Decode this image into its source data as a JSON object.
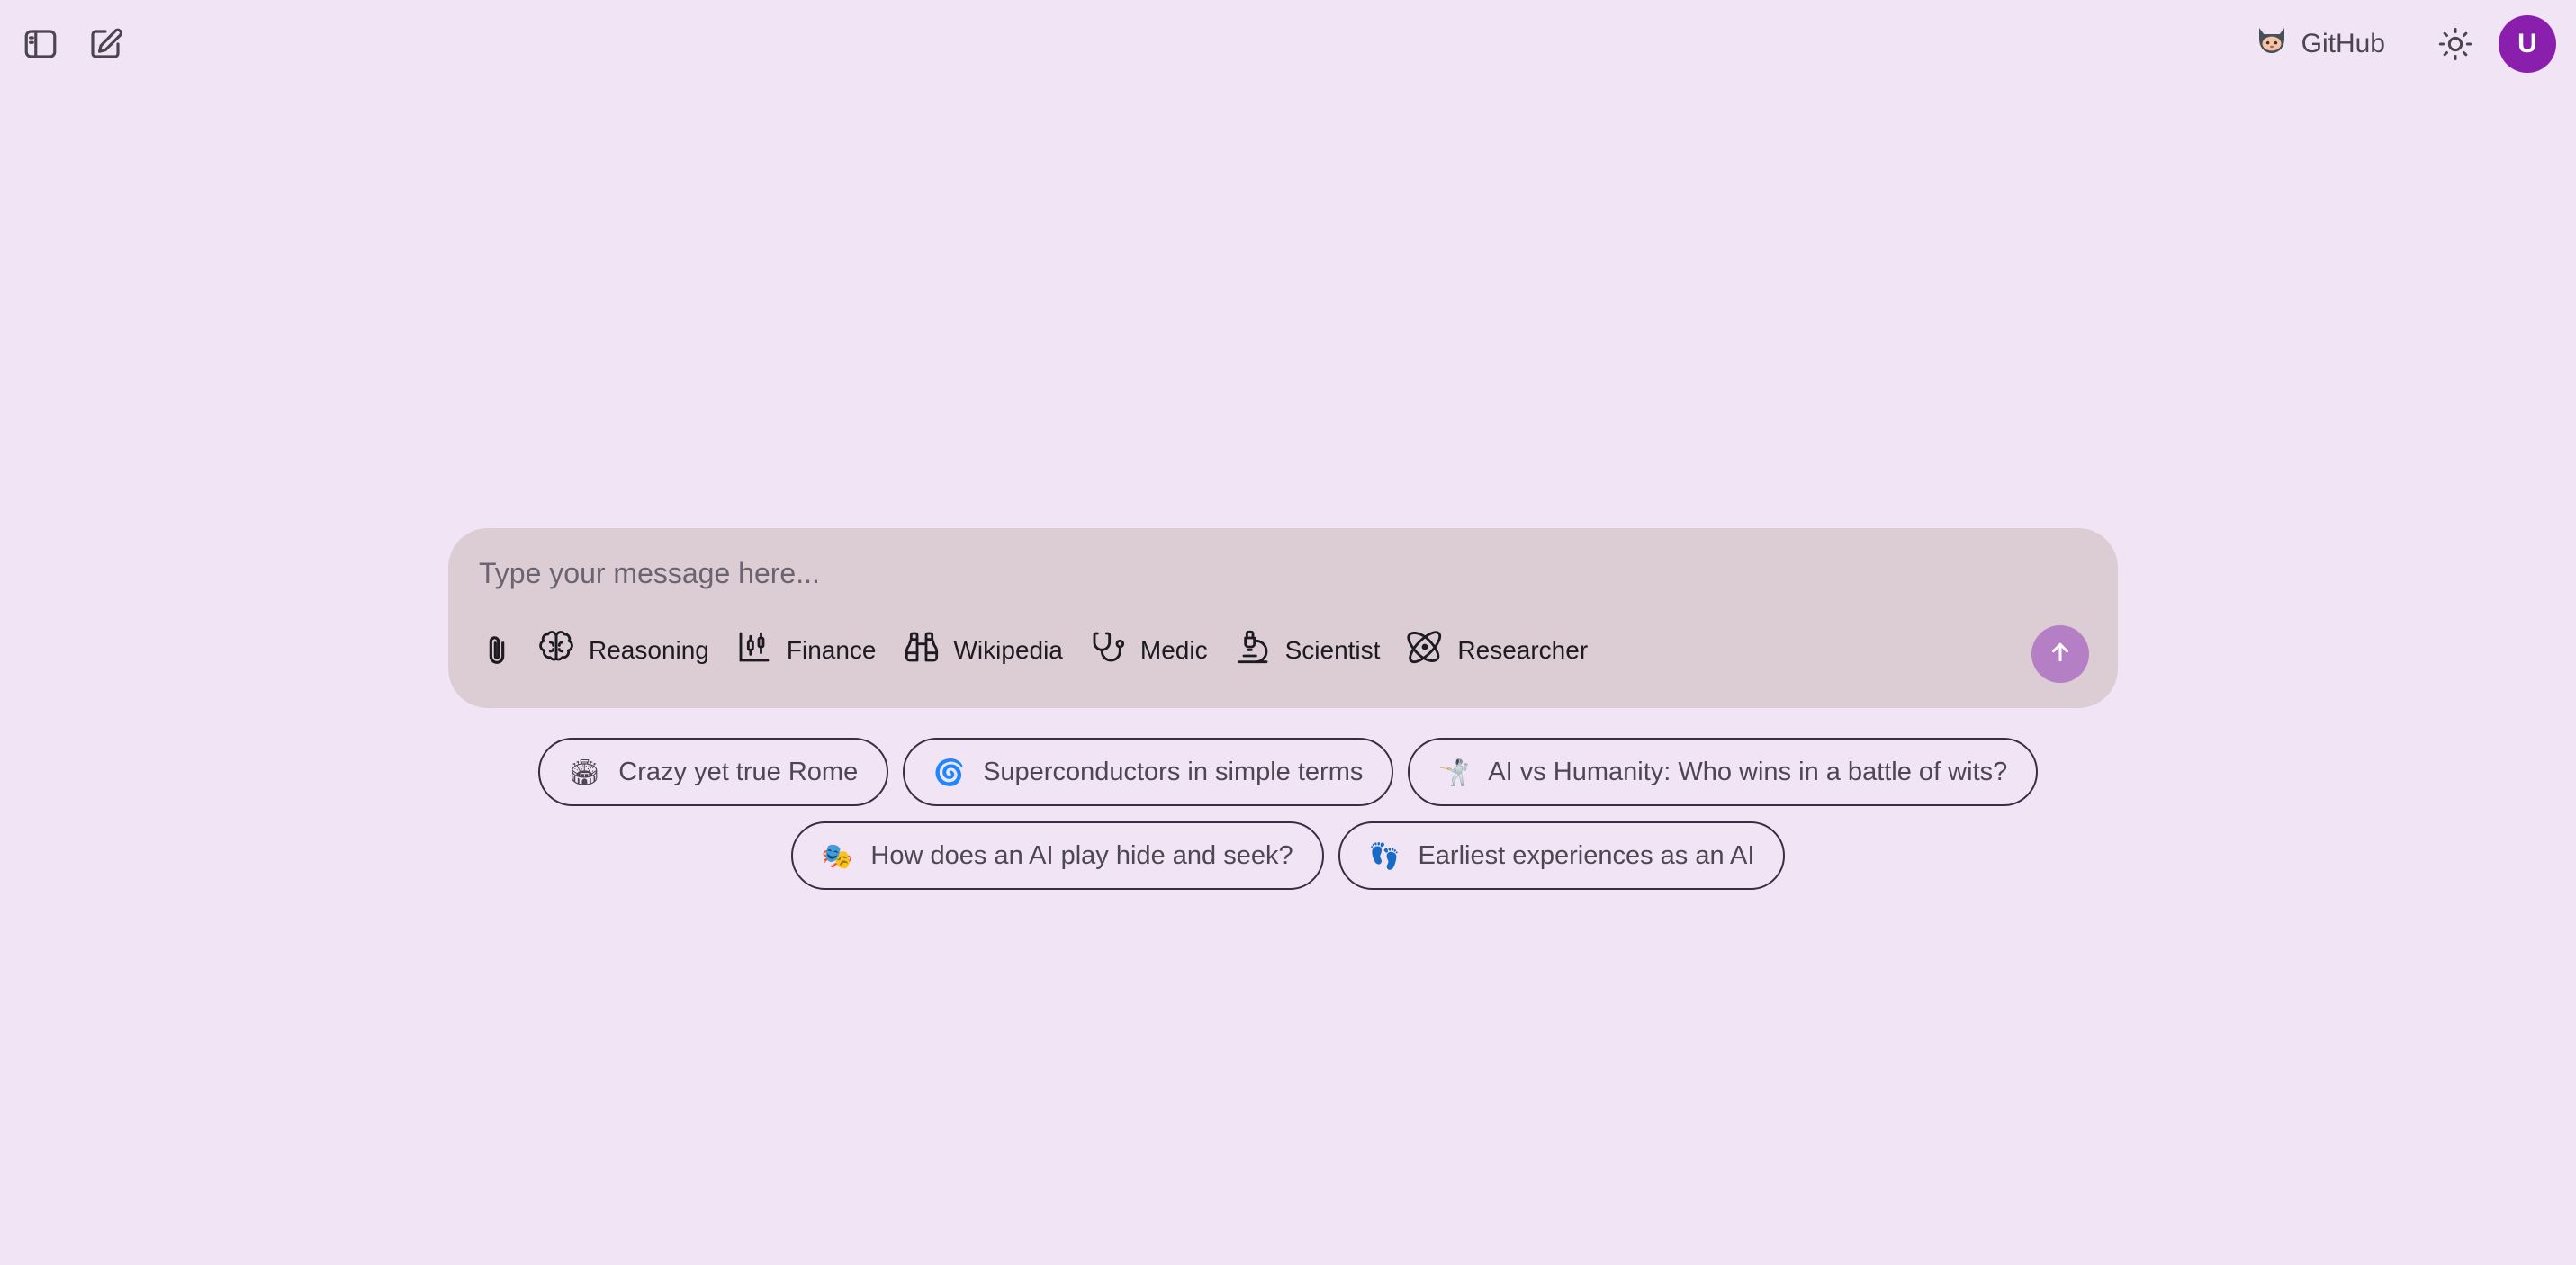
{
  "header": {
    "github_label": "GitHub",
    "avatar_initial": "U",
    "icons": {
      "sidebar_toggle": "sidebar-toggle-icon",
      "new_chat": "edit-icon",
      "github": "github-icon",
      "theme": "sun-icon"
    }
  },
  "composer": {
    "placeholder": "Type your message here...",
    "value": "",
    "tools": [
      {
        "label": "Reasoning",
        "icon": "brain-icon"
      },
      {
        "label": "Finance",
        "icon": "candlestick-chart-icon"
      },
      {
        "label": "Wikipedia",
        "icon": "binoculars-icon"
      },
      {
        "label": "Medic",
        "icon": "stethoscope-icon"
      },
      {
        "label": "Scientist",
        "icon": "microscope-icon"
      },
      {
        "label": "Researcher",
        "icon": "atom-icon"
      }
    ],
    "attach_icon": "paperclip-icon",
    "send_icon": "arrow-up-icon"
  },
  "suggestions": [
    {
      "emoji": "🏟",
      "label": "Crazy yet true Rome"
    },
    {
      "emoji": "🌀",
      "label": "Superconductors in simple terms"
    },
    {
      "emoji": "🤺",
      "label": "AI vs Humanity: Who wins in a battle of wits?"
    },
    {
      "emoji": "🎭",
      "label": "How does an AI play hide and seek?"
    },
    {
      "emoji": "👣",
      "label": "Earliest experiences as an AI"
    }
  ],
  "colors": {
    "background": "#f1e4f5",
    "composer": "#dccdd4",
    "accent": "#b57fc6",
    "avatar": "#8a1fae"
  }
}
